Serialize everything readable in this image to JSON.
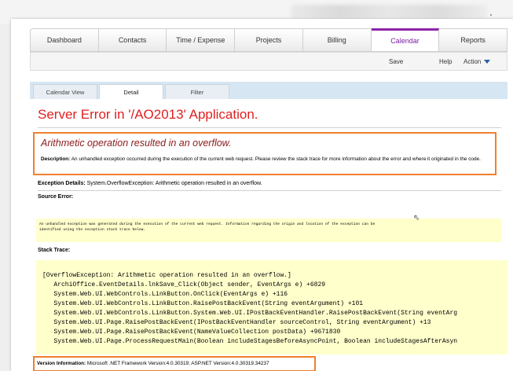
{
  "nav": {
    "tabs": [
      "Dashboard",
      "Contacts",
      "Time / Expense",
      "Projects",
      "Billing",
      "Calendar",
      "Reports"
    ],
    "active_tab": "Calendar"
  },
  "toolbar": {
    "save": "Save",
    "help": "Help",
    "action": "Action"
  },
  "subtabs": {
    "items": [
      "Calendar View",
      "Detail",
      "Filter"
    ],
    "active": "Detail"
  },
  "error": {
    "title": "Server Error in '/AO2013' Application.",
    "message": "Arithmetic operation resulted in an overflow.",
    "description_label": "Description:",
    "description_text": "An unhandled exception occurred during the execution of the current web request. Please review the stack trace for more information about the error and where it originated in the code.",
    "exception_label": "Exception Details:",
    "exception_text": "System.OverflowException: Arithmetic operation resulted in an overflow.",
    "source_label": "Source Error:",
    "source_text": "An unhandled exception was generated during the execution of the current web request. Information regarding the origin and location of the exception can be\nidentified using the exception stack trace below.",
    "stack_label": "Stack Trace:",
    "stack_lines": [
      "[OverflowException: Arithmetic operation resulted in an overflow.]",
      "   ArchiOffice.EventDetails.lnkSave_Click(Object sender, EventArgs e) +6829",
      "   System.Web.UI.WebControls.LinkButton.OnClick(EventArgs e) +116",
      "   System.Web.UI.WebControls.LinkButton.RaisePostBackEvent(String eventArgument) +101",
      "   System.Web.UI.WebControls.LinkButton.System.Web.UI.IPostBackEventHandler.RaisePostBackEvent(String eventArg",
      "   System.Web.UI.Page.RaisePostBackEvent(IPostBackEventHandler sourceControl, String eventArgument) +13",
      "   System.Web.UI.Page.RaisePostBackEvent(NameValueCollection postData) +9671830",
      "   System.Web.UI.Page.ProcessRequestMain(Boolean includeStagesBeforeAsyncPoint, Boolean includeStagesAfterAsyn"
    ],
    "version_label": "Version Information:",
    "version_text": "Microsoft .NET Framework Version:4.0.30319; ASP.NET Version:4.0.30319.34237"
  },
  "colors": {
    "accent": "#8e24aa",
    "error_red": "#e02020",
    "highlight": "#f07f2e",
    "stack_bg": "#ffffcc"
  }
}
